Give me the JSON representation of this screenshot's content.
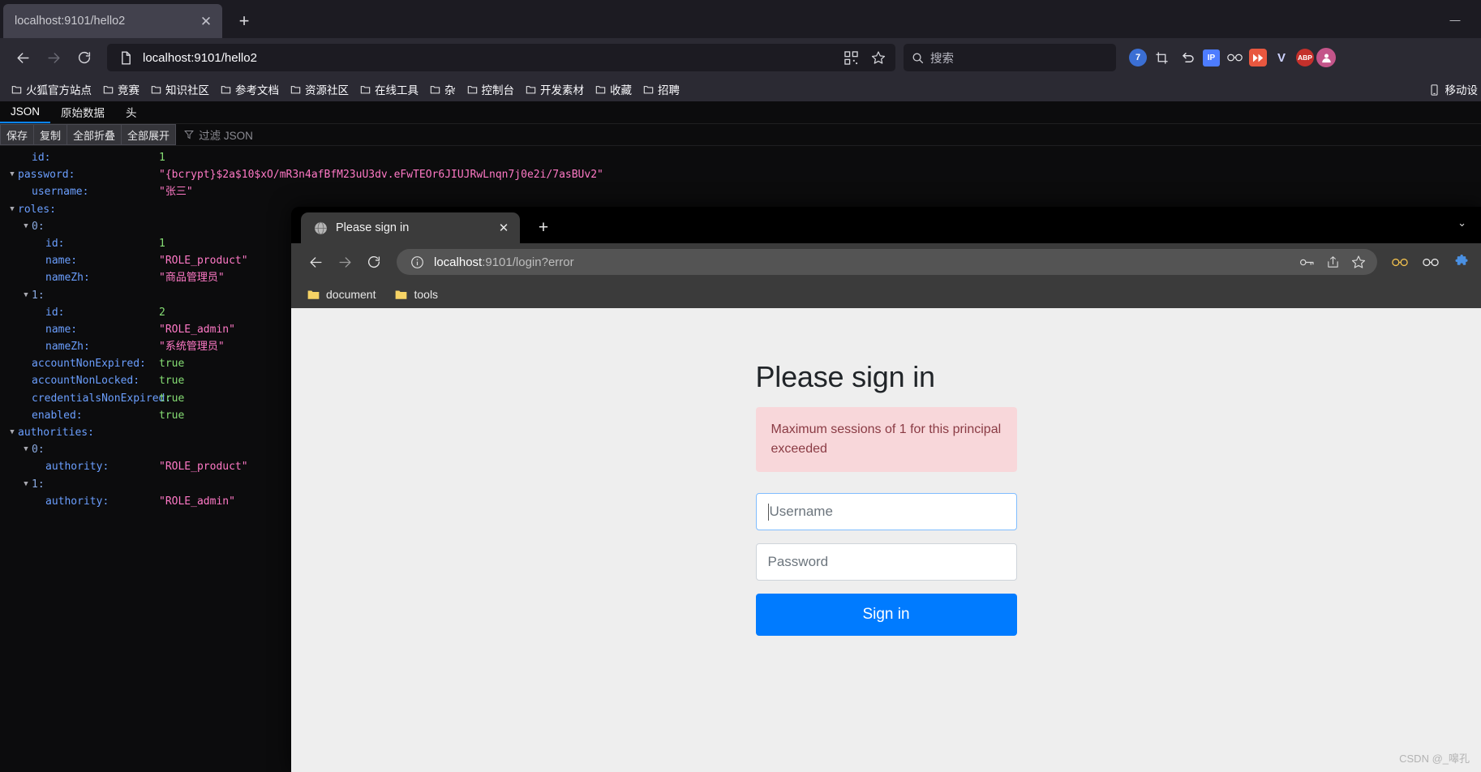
{
  "outer_browser": {
    "tab": {
      "title": "localhost:9101/hello2",
      "close": "✕"
    },
    "new_tab": "+",
    "window_controls": {
      "minimize": "—"
    },
    "nav": {
      "back": "back-arrow",
      "forward": "forward-arrow",
      "reload": "reload"
    },
    "urlbar": {
      "value": "localhost:9101/hello2",
      "page_icon": "document-icon"
    },
    "search": {
      "placeholder": "搜索"
    },
    "extensions": [
      {
        "name": "badge-7",
        "label": "7",
        "color": "#4a6bdd"
      },
      {
        "name": "crop-tool",
        "label": "",
        "color": "#2b2a33"
      },
      {
        "name": "undo-arrow",
        "label": "",
        "color": "#2b2a33"
      },
      {
        "name": "ip-tool",
        "label": "IP",
        "color": "#4d7cff"
      },
      {
        "name": "glasses-ext",
        "label": "",
        "color": "#2b2a33"
      },
      {
        "name": "fast-forward",
        "label": "",
        "color": "#e8573f"
      },
      {
        "name": "vimium-v",
        "label": "V",
        "color": "#2b2a33"
      },
      {
        "name": "adblock-plus",
        "label": "ABP",
        "color": "#c4302b"
      },
      {
        "name": "account-avatar",
        "label": "",
        "color": "#b5446e"
      }
    ],
    "bookmarks": [
      "火狐官方站点",
      "竞赛",
      "知识社区",
      "参考文档",
      "资源社区",
      "在线工具",
      "杂",
      "控制台",
      "开发素材",
      "收藏",
      "招聘"
    ],
    "bookmarks_right": "移动设"
  },
  "json_viewer": {
    "tabs": [
      {
        "label": "JSON",
        "active": true
      },
      {
        "label": "原始数据",
        "active": false
      },
      {
        "label": "头",
        "active": false
      }
    ],
    "toolbar_buttons": [
      "保存",
      "复制",
      "全部折叠",
      "全部展开"
    ],
    "filter_placeholder": "过滤 JSON",
    "rows": [
      {
        "indent": 1,
        "twisty": "",
        "key": "id:",
        "value": "1",
        "type": "num"
      },
      {
        "indent": 0,
        "twisty": "▼",
        "key": "password:",
        "value": "\"{bcrypt}$2a$10$xO/mR3n4afBfM23uU3dv.eFwTEOr6JIUJRwLnqn7j0e2i/7asBUv2\"",
        "type": "str"
      },
      {
        "indent": 1,
        "twisty": "",
        "key": "username:",
        "value": "\"张三\"",
        "type": "str"
      },
      {
        "indent": 0,
        "twisty": "▼",
        "key": "roles:",
        "value": "",
        "type": "none"
      },
      {
        "indent": 1,
        "twisty": "▼",
        "key": "0:",
        "value": "",
        "type": "none",
        "isIndex": true
      },
      {
        "indent": 2,
        "twisty": "",
        "key": "id:",
        "value": "1",
        "type": "num"
      },
      {
        "indent": 2,
        "twisty": "",
        "key": "name:",
        "value": "\"ROLE_product\"",
        "type": "str"
      },
      {
        "indent": 2,
        "twisty": "",
        "key": "nameZh:",
        "value": "\"商品管理员\"",
        "type": "str"
      },
      {
        "indent": 1,
        "twisty": "▼",
        "key": "1:",
        "value": "",
        "type": "none",
        "isIndex": true
      },
      {
        "indent": 2,
        "twisty": "",
        "key": "id:",
        "value": "2",
        "type": "num"
      },
      {
        "indent": 2,
        "twisty": "",
        "key": "name:",
        "value": "\"ROLE_admin\"",
        "type": "str"
      },
      {
        "indent": 2,
        "twisty": "",
        "key": "nameZh:",
        "value": "\"系统管理员\"",
        "type": "str"
      },
      {
        "indent": 1,
        "twisty": "",
        "key": "accountNonExpired:",
        "value": "true",
        "type": "num"
      },
      {
        "indent": 1,
        "twisty": "",
        "key": "accountNonLocked:",
        "value": "true",
        "type": "num"
      },
      {
        "indent": 1,
        "twisty": "",
        "key": "credentialsNonExpired:",
        "value": "true",
        "type": "num"
      },
      {
        "indent": 1,
        "twisty": "",
        "key": "enabled:",
        "value": "true",
        "type": "num"
      },
      {
        "indent": 0,
        "twisty": "▼",
        "key": "authorities:",
        "value": "",
        "type": "none"
      },
      {
        "indent": 1,
        "twisty": "▼",
        "key": "0:",
        "value": "",
        "type": "none",
        "isIndex": true
      },
      {
        "indent": 2,
        "twisty": "",
        "key": "authority:",
        "value": "\"ROLE_product\"",
        "type": "str"
      },
      {
        "indent": 1,
        "twisty": "▼",
        "key": "1:",
        "value": "",
        "type": "none",
        "isIndex": true
      },
      {
        "indent": 2,
        "twisty": "",
        "key": "authority:",
        "value": "\"ROLE_admin\"",
        "type": "str"
      }
    ]
  },
  "inner_browser": {
    "tab": {
      "title": "Please sign in",
      "close": "✕"
    },
    "new_tab": "+",
    "chevron": "⌄",
    "omnibox": {
      "host": "localhost",
      "rest": ":9101/login?error",
      "info_icon": "info-circle-icon"
    },
    "bookmarks": [
      {
        "label": "document"
      },
      {
        "label": "tools"
      }
    ],
    "right_icons": [
      "password-key-icon",
      "share-icon",
      "star-icon",
      "glasses-icon",
      "extension-icon",
      "puzzle-icon"
    ]
  },
  "login_page": {
    "title": "Please sign in",
    "alert": "Maximum sessions of 1 for this principal exceeded",
    "username_placeholder": "Username",
    "password_placeholder": "Password",
    "submit_label": "Sign in",
    "accent_color": "#007bff",
    "alert_bg": "#f8d7da"
  },
  "watermark": "CSDN @_嗥孔"
}
